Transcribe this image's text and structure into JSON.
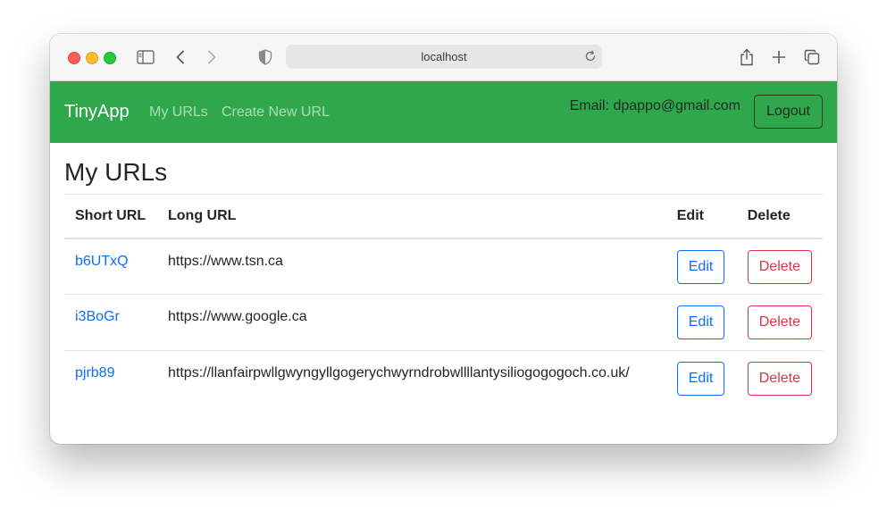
{
  "browser": {
    "address": "localhost",
    "icons": [
      "sidebar-icon",
      "back-icon",
      "forward-icon",
      "shield-icon",
      "reload-icon",
      "share-icon",
      "new-tab-icon",
      "tabs-icon"
    ]
  },
  "navbar": {
    "brand": "TinyApp",
    "links": [
      {
        "label": "My URLs"
      },
      {
        "label": "Create New URL"
      }
    ],
    "email": "Email: dpappo@gmail.com",
    "logout": "Logout",
    "color": "#2fa84b"
  },
  "page": {
    "title": "My URLs"
  },
  "table": {
    "headers": [
      "Short URL",
      "Long URL",
      "Edit",
      "Delete"
    ],
    "rows": [
      {
        "short": "b6UTxQ",
        "long": "https://www.tsn.ca",
        "edit": "Edit",
        "delete": "Delete"
      },
      {
        "short": "i3BoGr",
        "long": "https://www.google.ca",
        "edit": "Edit",
        "delete": "Delete"
      },
      {
        "short": "pjrb89",
        "long": "https://llanfairpwllgwyngyllgogerychwyrndrobwllllantysiliogogogoch.co.uk/",
        "edit": "Edit",
        "delete": "Delete"
      }
    ]
  },
  "colors": {
    "link": "#0d6efd",
    "danger": "#dc3545"
  }
}
